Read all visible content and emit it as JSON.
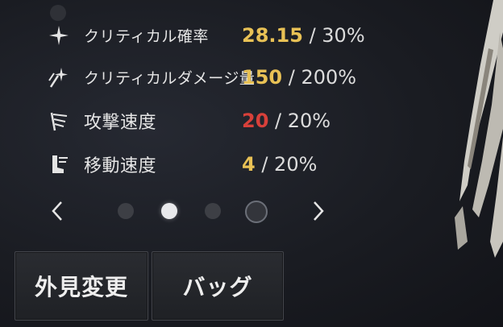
{
  "stats": [
    {
      "label": "クリティカル確率",
      "current": "28.15",
      "max": "/ 30%",
      "current_color": "#e8c155",
      "icon": "sparkle-icon"
    },
    {
      "label": "クリティカルダメージ量",
      "current": "150",
      "max": "/ 200%",
      "current_color": "#e8c155",
      "icon": "critical-damage-icon"
    },
    {
      "label": "攻撃速度",
      "current": "20",
      "max": "/ 20%",
      "current_color": "#d8403a",
      "icon": "attack-speed-icon"
    },
    {
      "label": "移動速度",
      "current": "4",
      "max": "/ 20%",
      "current_color": "#e8c155",
      "icon": "move-speed-icon"
    }
  ],
  "pager": {
    "pages": 4,
    "active_index": 1
  },
  "buttons": {
    "appearance": "外見変更",
    "bag": "バッグ"
  }
}
